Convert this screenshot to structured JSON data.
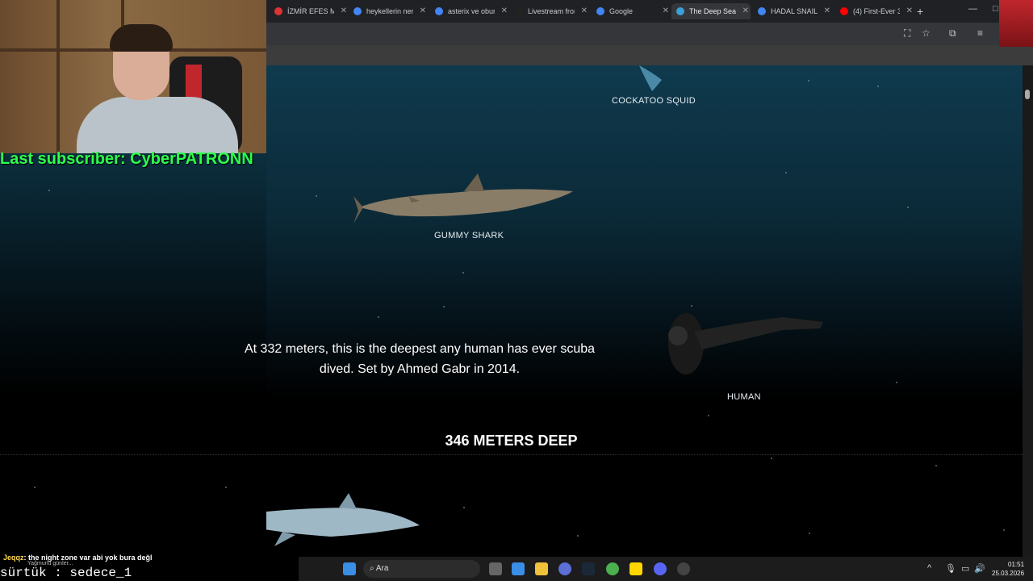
{
  "browser": {
    "tabs": [
      {
        "title": "İZMİR EFES MÜ",
        "color": "#d33"
      },
      {
        "title": "heykellerin nerede",
        "color": "#4285f4"
      },
      {
        "title": "asterix ve obur",
        "color": "#4285f4"
      },
      {
        "title": "Livestream from",
        "color": "#222"
      },
      {
        "title": "Google",
        "color": "#4285f4"
      },
      {
        "title": "The Deep Sea",
        "color": "#3aa0d8",
        "active": true
      },
      {
        "title": "HADAL SNAIL",
        "color": "#4285f4"
      },
      {
        "title": "(4) First-Ever 3D",
        "color": "#ff0000"
      }
    ],
    "new_tab": "+",
    "close_glyph": "✕"
  },
  "page": {
    "creatures": [
      {
        "name": "COCKATOO SQUID"
      },
      {
        "name": "GUMMY SHARK"
      },
      {
        "name": "HUMAN"
      }
    ],
    "fact": "At 332 meters, this is the deepest any human has ever scuba dived. Set by Ahmed Gabr in 2014.",
    "depth": "346 METERS DEEP"
  },
  "overlay": {
    "subscriber": "Last subscriber: CyberPATRONN",
    "chat_user": "Jeqqz",
    "chat_text": ": the night zone var abi yok bura değl",
    "chat_sub": "Yağmurlu günler...",
    "sozluk": "sürtük : sedece_1"
  },
  "taskbar": {
    "search_placeholder": "Ara",
    "time": "01:51",
    "date": "25.03.2026"
  }
}
